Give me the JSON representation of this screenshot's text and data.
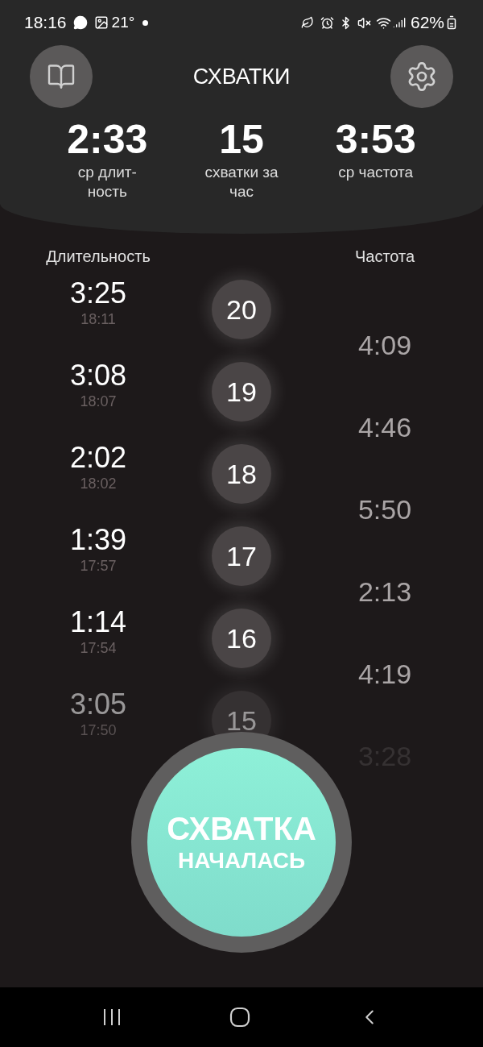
{
  "status_bar": {
    "time": "18:16",
    "temperature": "21°",
    "battery": "62%"
  },
  "header": {
    "title": "СХВАТКИ"
  },
  "stats": [
    {
      "value": "2:33",
      "label": "ср длит-ность"
    },
    {
      "value": "15",
      "label": "схватки за час"
    },
    {
      "value": "3:53",
      "label": "ср частота"
    }
  ],
  "columns": {
    "duration": "Длительность",
    "frequency": "Частота"
  },
  "rows": [
    {
      "duration": "3:25",
      "time": "18:11",
      "number": "20",
      "frequency": "4:09"
    },
    {
      "duration": "3:08",
      "time": "18:07",
      "number": "19",
      "frequency": "4:46"
    },
    {
      "duration": "2:02",
      "time": "18:02",
      "number": "18",
      "frequency": "5:50"
    },
    {
      "duration": "1:39",
      "time": "17:57",
      "number": "17",
      "frequency": "2:13"
    },
    {
      "duration": "1:14",
      "time": "17:54",
      "number": "16",
      "frequency": "4:19"
    },
    {
      "duration": "3:05",
      "time": "17:50",
      "number": "15",
      "frequency": "3:28"
    }
  ],
  "start_button": {
    "line1": "СХВАТКА",
    "line2": "НАЧАЛАСЬ"
  }
}
